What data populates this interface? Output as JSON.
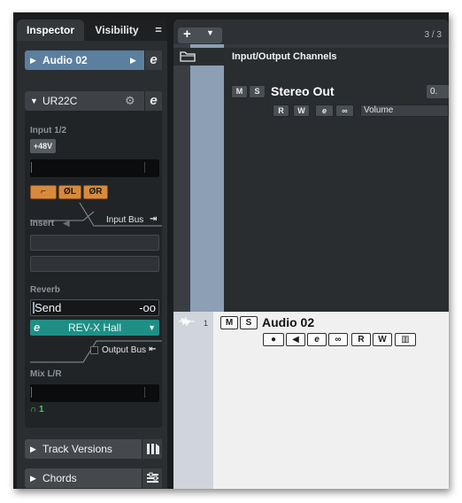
{
  "inspector": {
    "tabs": {
      "inspector": "Inspector",
      "visibility": "Visibility",
      "menu": "="
    },
    "track": {
      "name": "Audio 02",
      "arrow": "▶",
      "edit": "e"
    },
    "ur22c": {
      "title": "UR22C",
      "input_label": "Input 1/2",
      "phantom": "+48V",
      "buttons": {
        "hpf": "⌐",
        "phase_l": "ØL",
        "phase_r": "ØR"
      },
      "insert": "Insert",
      "input_bus": "Input Bus",
      "reverb": "Reverb",
      "send_label": "Send",
      "send_value": "-oo",
      "reverb_type": "REV-X Hall",
      "output_bus": "Output Bus",
      "mix": "Mix L/R",
      "headphones": "1"
    },
    "track_versions": "Track Versions",
    "chords": "Chords"
  },
  "project": {
    "add": "+",
    "count": "3 / 3",
    "folder_title": "Input/Output Channels",
    "stereo_out": {
      "m": "M",
      "s": "S",
      "name": "Stereo Out",
      "r": "R",
      "w": "W",
      "e": "e",
      "link": "∞",
      "volume": "Volume",
      "value": "0."
    },
    "audio_track": {
      "number": "1",
      "m": "M",
      "s": "S",
      "name": "Audio 02",
      "rec": "●",
      "mon": "◀",
      "e": "e",
      "link": "∞",
      "r": "R",
      "w": "W",
      "lane": "▥"
    }
  }
}
